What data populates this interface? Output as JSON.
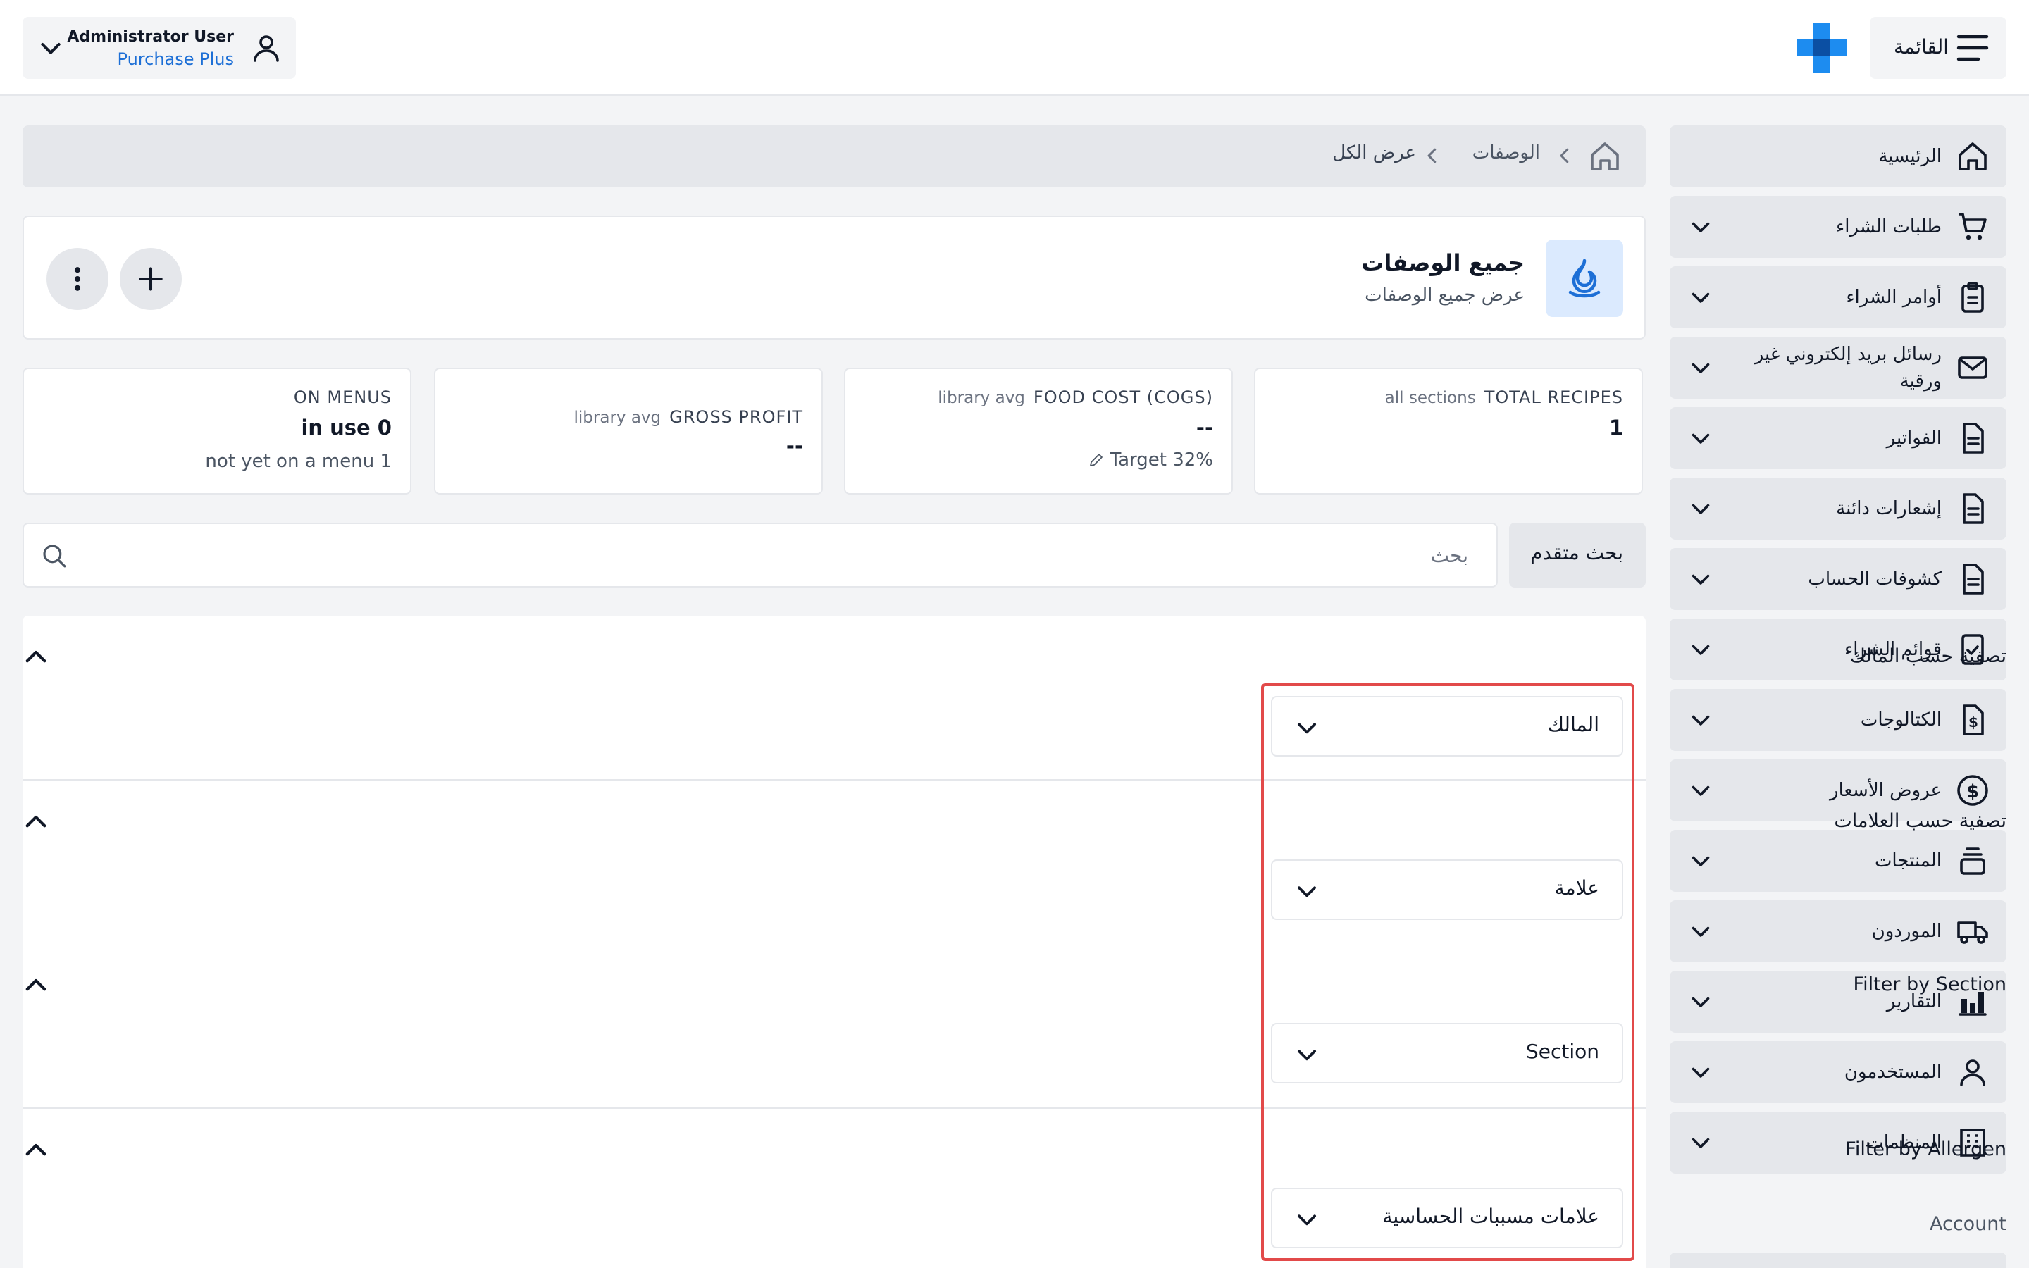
{
  "header": {
    "menu_label": "القائمة",
    "user_name": "Administrator User",
    "user_org": "Purchase Plus",
    "brand_color": "#1d8cf0"
  },
  "sidebar": {
    "items": [
      {
        "label": "الرئيسية",
        "icon": "home-icon"
      },
      {
        "label": "طلبات الشراء",
        "icon": "cart-icon"
      },
      {
        "label": "أوامر الشراء",
        "icon": "clipboard-icon"
      },
      {
        "label": "رسائل بريد إلكتروني غير ورقية",
        "icon": "mail-icon"
      },
      {
        "label": "الفواتير",
        "icon": "document-icon"
      },
      {
        "label": "إشعارات دائنة",
        "icon": "document-icon"
      },
      {
        "label": "كشوفات الحساب",
        "icon": "document-icon"
      },
      {
        "label": "قوائم الشراء",
        "icon": "checklist-icon"
      },
      {
        "label": "الكتالوجات",
        "icon": "catalog-icon"
      },
      {
        "label": "عروض الأسعار",
        "icon": "dollar-icon"
      },
      {
        "label": "المنتجات",
        "icon": "box-icon"
      },
      {
        "label": "الموردون",
        "icon": "truck-icon"
      },
      {
        "label": "التقارير",
        "icon": "chart-icon"
      },
      {
        "label": "المستخدمون",
        "icon": "user-icon"
      },
      {
        "label": "المنظمات",
        "icon": "building-icon"
      }
    ],
    "account_label": "Account"
  },
  "breadcrumb": {
    "items": [
      "الوصفات",
      "عرض الكل"
    ]
  },
  "page": {
    "title": "جميع الوصفات",
    "subtitle": "عرض جميع الوصفات"
  },
  "stats": {
    "total": {
      "sub": "all sections",
      "head": "TOTAL RECIPES",
      "value": "1"
    },
    "cost": {
      "sub": "library avg",
      "head": "FOOD COST (COGS)",
      "value": "--",
      "foot": "Target 32%"
    },
    "profit": {
      "sub": "library avg",
      "head": "GROSS PROFIT",
      "value": "--"
    },
    "menus": {
      "head": "ON MENUS",
      "value": "in use 0",
      "foot": "not yet on a menu 1"
    }
  },
  "search": {
    "placeholder": "بحث",
    "advanced_label": "بحث متقدم"
  },
  "filters": [
    {
      "title": "تصفية حسب المالك",
      "value": "المالك"
    },
    {
      "title": "تصفية حسب العلامات",
      "value": "علامة"
    },
    {
      "title": "Filter by Section",
      "value": "Section"
    },
    {
      "title": "Filter by Allergen",
      "value": "علامات مسببات الحساسية"
    }
  ]
}
